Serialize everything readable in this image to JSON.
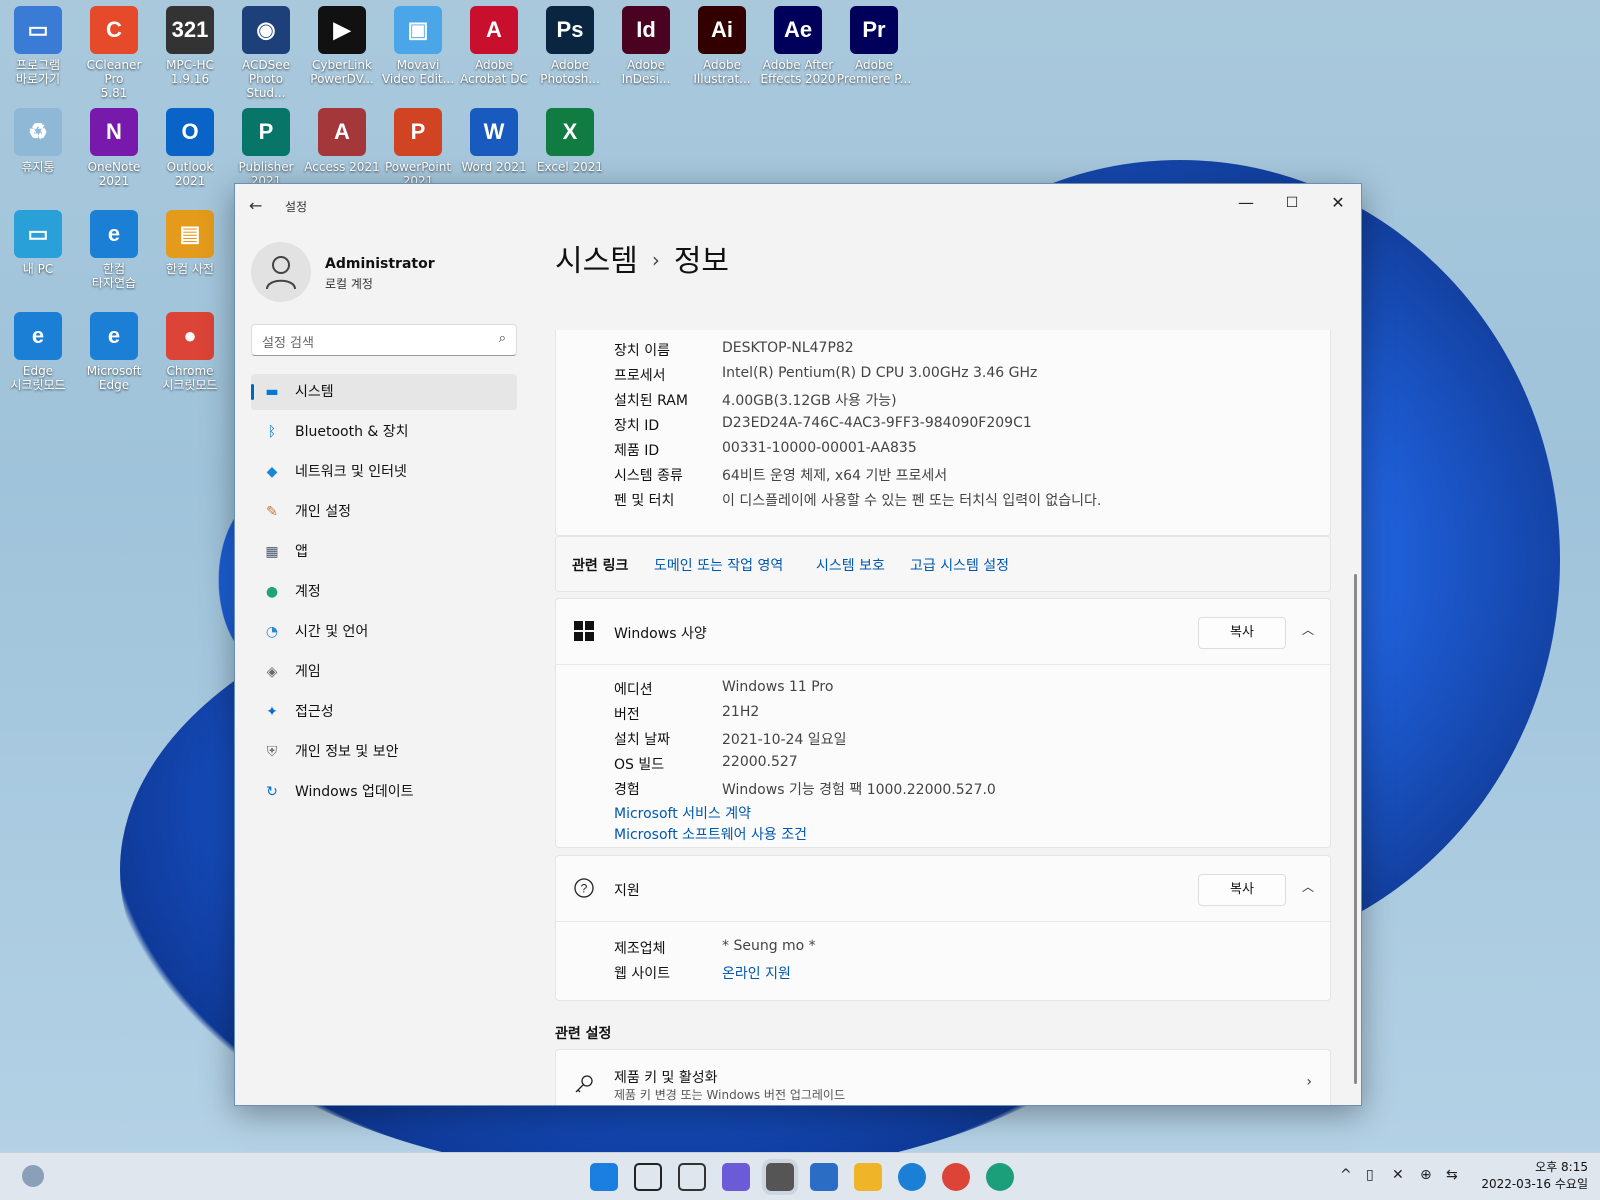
{
  "desktop": {
    "icons": [
      {
        "label": "프로그램\n바로가기",
        "glyph": "▭",
        "color": "#3a7bd5"
      },
      {
        "label": "CCleaner Pro\n5.81",
        "glyph": "C",
        "color": "#e54b2a"
      },
      {
        "label": "MPC-HC\n1.9.16",
        "glyph": "321",
        "color": "#333333"
      },
      {
        "label": "ACDSee\nPhoto Stud...",
        "glyph": "◉",
        "color": "#1d3f7a"
      },
      {
        "label": "CyberLink\nPowerDV...",
        "glyph": "▶",
        "color": "#111111"
      },
      {
        "label": "Movavi\nVideo Edit...",
        "glyph": "▣",
        "color": "#4aa6e8"
      },
      {
        "label": "Adobe\nAcrobat DC",
        "glyph": "A",
        "color": "#c8102e"
      },
      {
        "label": "Adobe\nPhotosh...",
        "glyph": "Ps",
        "color": "#0a2540"
      },
      {
        "label": "Adobe\nInDesi...",
        "glyph": "Id",
        "color": "#49021f"
      },
      {
        "label": "Adobe\nIllustrat...",
        "glyph": "Ai",
        "color": "#330000"
      },
      {
        "label": "Adobe After\nEffects 2020",
        "glyph": "Ae",
        "color": "#00005b"
      },
      {
        "label": "Adobe\nPremiere P...",
        "glyph": "Pr",
        "color": "#00005b"
      },
      {
        "label": "휴지통",
        "glyph": "♻",
        "color": "#8fb7d6"
      },
      {
        "label": "OneNote\n2021",
        "glyph": "N",
        "color": "#7719aa"
      },
      {
        "label": "Outlook\n2021",
        "glyph": "O",
        "color": "#0a64c8"
      },
      {
        "label": "Publisher\n2021",
        "glyph": "P",
        "color": "#077568"
      },
      {
        "label": "Access 2021",
        "glyph": "A",
        "color": "#a4373a"
      },
      {
        "label": "PowerPoint\n2021",
        "glyph": "P",
        "color": "#d04423"
      },
      {
        "label": "Word 2021",
        "glyph": "W",
        "color": "#185abd"
      },
      {
        "label": "Excel 2021",
        "glyph": "X",
        "color": "#107c41"
      },
      {
        "label": "내 PC",
        "glyph": "▭",
        "color": "#2aa0d8"
      },
      {
        "label": "한컴\n타자연습",
        "glyph": "e",
        "color": "#1b7fd6"
      },
      {
        "label": "한컴 사전",
        "glyph": "▤",
        "color": "#e49b1b"
      },
      {
        "label": "Edge\n시크릿모드",
        "glyph": "e",
        "color": "#1b7fd6"
      },
      {
        "label": "Microsoft\nEdge",
        "glyph": "e",
        "color": "#1b7fd6"
      },
      {
        "label": "Chrome\n시크릿모드",
        "glyph": "●",
        "color": "#db4437"
      }
    ]
  },
  "window": {
    "app_title": "설정",
    "back_glyph": "←",
    "minimize_glyph": "—",
    "maximize_glyph": "☐",
    "close_glyph": "✕"
  },
  "sidebar": {
    "user_name": "Administrator",
    "user_type": "로컬 계정",
    "search_placeholder": "설정 검색",
    "search_glyph": "⌕",
    "items": [
      {
        "label": "시스템",
        "glyph": "▬",
        "color": "#0078d4"
      },
      {
        "label": "Bluetooth & 장치",
        "glyph": "ᛒ",
        "color": "#0078d4"
      },
      {
        "label": "네트워크 및 인터넷",
        "glyph": "◆",
        "color": "#1a86d8"
      },
      {
        "label": "개인 설정",
        "glyph": "✎",
        "color": "#c4783a"
      },
      {
        "label": "앱",
        "glyph": "▦",
        "color": "#4a5a70"
      },
      {
        "label": "계정",
        "glyph": "●",
        "color": "#1fa37a"
      },
      {
        "label": "시간 및 언어",
        "glyph": "◔",
        "color": "#2a88d0"
      },
      {
        "label": "게임",
        "glyph": "◈",
        "color": "#6a6a6a"
      },
      {
        "label": "접근성",
        "glyph": "✦",
        "color": "#0a6ed1"
      },
      {
        "label": "개인 정보 및 보안",
        "glyph": "⛨",
        "color": "#6a6a6a"
      },
      {
        "label": "Windows 업데이트",
        "glyph": "↻",
        "color": "#0a6ed1"
      }
    ]
  },
  "main": {
    "breadcrumb_parent": "시스템",
    "breadcrumb_sep": "›",
    "breadcrumb_current": "정보",
    "device_specs": [
      {
        "label": "장치 이름",
        "value": "DESKTOP-NL47P82"
      },
      {
        "label": "프로세서",
        "value": "Intel(R) Pentium(R) D CPU 3.00GHz   3.46 GHz"
      },
      {
        "label": "설치된 RAM",
        "value": "4.00GB(3.12GB 사용 가능)"
      },
      {
        "label": "장치 ID",
        "value": "D23ED24A-746C-4AC3-9FF3-984090F209C1"
      },
      {
        "label": "제품 ID",
        "value": "00331-10000-00001-AA835"
      },
      {
        "label": "시스템 종류",
        "value": "64비트 운영 체제, x64 기반 프로세서"
      },
      {
        "label": "펜 및 터치",
        "value": "이 디스플레이에 사용할 수 있는 펜 또는 터치식 입력이 없습니다."
      }
    ],
    "related_links_label": "관련 링크",
    "related_links": [
      "도메인 또는 작업 영역",
      "시스템 보호",
      "고급 시스템 설정"
    ],
    "windows_spec": {
      "title": "Windows 사양",
      "copy_label": "복사",
      "rows": [
        {
          "label": "에디션",
          "value": "Windows 11 Pro"
        },
        {
          "label": "버전",
          "value": "21H2"
        },
        {
          "label": "설치 날짜",
          "value": "2021-10-24 일요일"
        },
        {
          "label": "OS 빌드",
          "value": "22000.527"
        },
        {
          "label": "경험",
          "value": "Windows 기능 경험 팩 1000.22000.527.0"
        }
      ],
      "links": [
        "Microsoft 서비스 계약",
        "Microsoft 소프트웨어 사용 조건"
      ]
    },
    "support": {
      "title": "지원",
      "copy_label": "복사",
      "manufacturer_label": "제조업체",
      "manufacturer_value": "* Seung mo *",
      "website_label": "웹 사이트",
      "website_value": "온라인 지원"
    },
    "related_settings_label": "관련 설정",
    "product_key": {
      "title": "제품 키 및 활성화",
      "subtitle": "제품 키 변경 또는 Windows 버전 업그레이드"
    }
  },
  "taskbar": {
    "clock_time": "오후 8:15",
    "clock_date": "2022-03-16 수요일",
    "tray_glyphs": [
      "^",
      "▯",
      "✕",
      "⊕",
      "⇆"
    ],
    "app_icons": [
      {
        "name": "start",
        "color": "#1a7fe0"
      },
      {
        "name": "search",
        "color": "#222222"
      },
      {
        "name": "task-view",
        "color": "#333333"
      },
      {
        "name": "chat",
        "color": "#6b5bd6"
      },
      {
        "name": "settings",
        "color": "#555555"
      },
      {
        "name": "store",
        "color": "#2b6cc4"
      },
      {
        "name": "explorer",
        "color": "#f0b429"
      },
      {
        "name": "edge",
        "color": "#1b7fd6"
      },
      {
        "name": "chrome",
        "color": "#db4437"
      },
      {
        "name": "edge-dev",
        "color": "#1a9f7a"
      }
    ]
  }
}
